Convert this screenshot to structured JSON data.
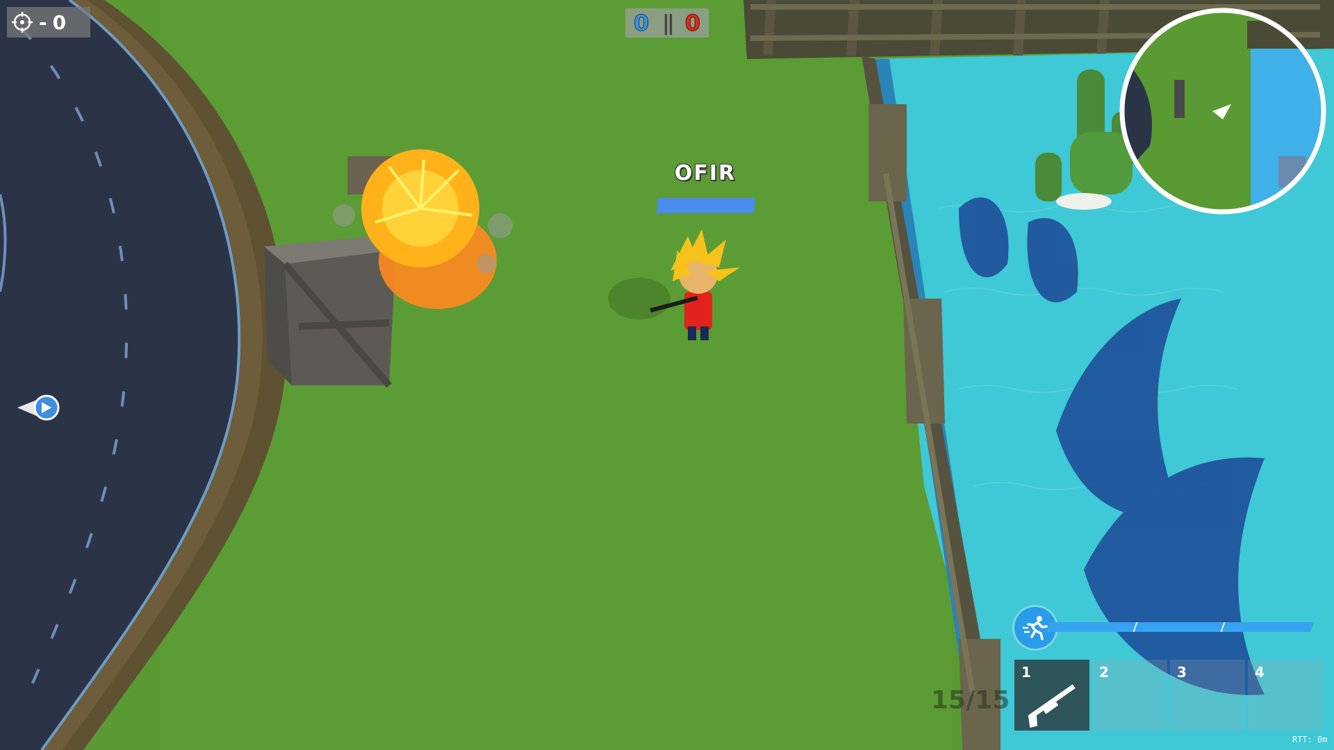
{
  "hud": {
    "kill_counter": {
      "icon": "crosshair-icon",
      "separator": "-",
      "value": "0"
    },
    "team_score": {
      "blue": "0",
      "separator": "||",
      "red": "0",
      "blue_color": "#3f8ee0",
      "red_color": "#e0291e"
    },
    "player": {
      "name": "OFIR",
      "health_fraction": 1.0
    },
    "sprint": {
      "icon": "running-person-icon",
      "fill_fraction": 1.0
    },
    "ammo": "15/15",
    "weapon_slots": [
      {
        "number": "1",
        "weapon": "shotgun-icon",
        "active": true
      },
      {
        "number": "2",
        "weapon": "",
        "active": false
      },
      {
        "number": "3",
        "weapon": "",
        "active": false
      },
      {
        "number": "4",
        "weapon": "",
        "active": false
      }
    ],
    "rtt": "RTT: 0m"
  },
  "colors": {
    "grass": "#5a9a33",
    "road": "#2b3446",
    "water": "#3ec7d4",
    "accent_blue": "#36a3f0"
  }
}
